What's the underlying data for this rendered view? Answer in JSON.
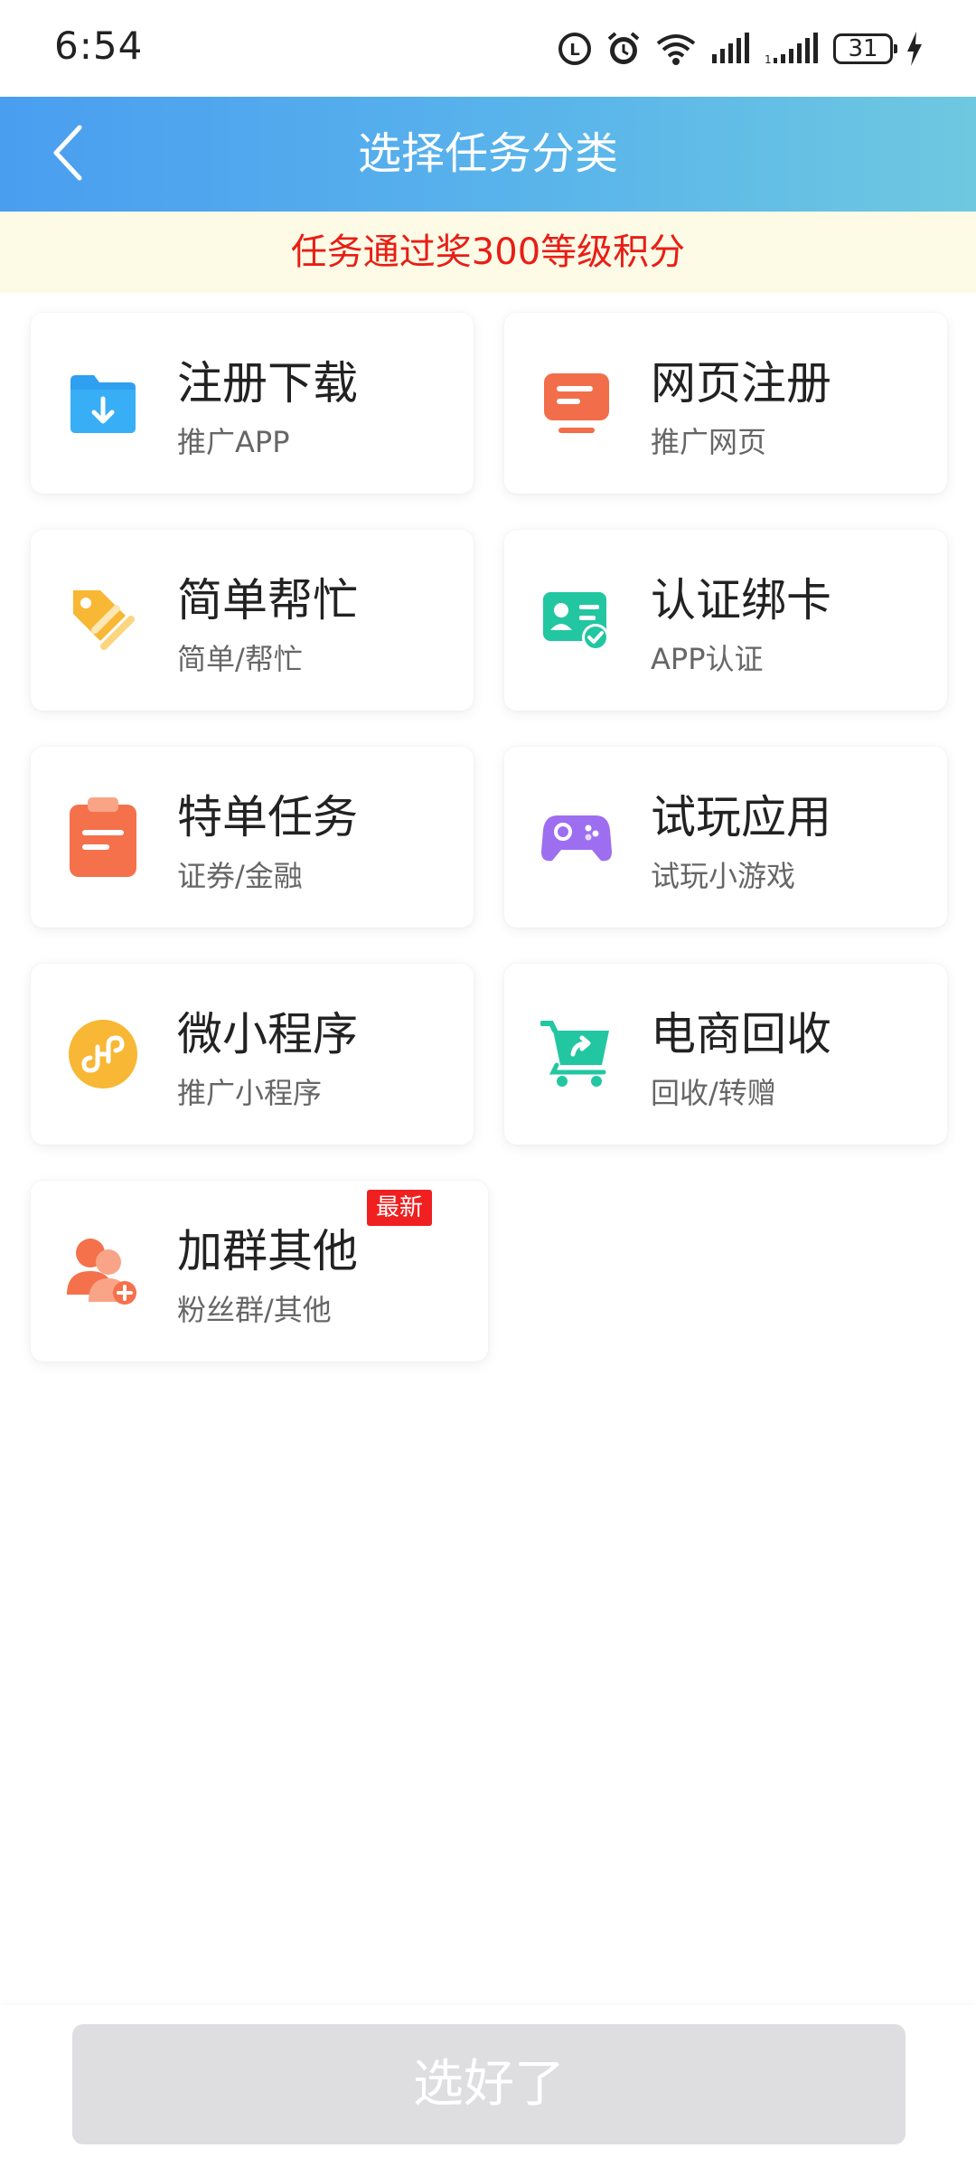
{
  "status_bar": {
    "time": "6:54",
    "battery": "31",
    "icons": [
      "data-saver-icon",
      "alarm-icon",
      "wifi-icon",
      "signal-icon",
      "signal-icon-2",
      "battery-icon",
      "charging-icon"
    ]
  },
  "header": {
    "title": "选择任务分类",
    "back_icon": "chevron-left-icon"
  },
  "notice": {
    "text": "任务通过奖300等级积分"
  },
  "categories": [
    {
      "title": "注册下载",
      "subtitle": "推广APP",
      "icon": "folder-download-icon",
      "color": "#2f9ff0"
    },
    {
      "title": "网页注册",
      "subtitle": "推广网页",
      "icon": "webpage-icon",
      "color": "#f26e4a"
    },
    {
      "title": "简单帮忙",
      "subtitle": "简单/帮忙",
      "icon": "tag-icon",
      "color": "#f8b734"
    },
    {
      "title": "认证绑卡",
      "subtitle": "APP认证",
      "icon": "id-card-icon",
      "color": "#22c7a1"
    },
    {
      "title": "特单任务",
      "subtitle": "证券/金融",
      "icon": "clipboard-icon",
      "color": "#f4714c"
    },
    {
      "title": "试玩应用",
      "subtitle": "试玩小游戏",
      "icon": "gamepad-icon",
      "color": "#9e6ef0"
    },
    {
      "title": "微小程序",
      "subtitle": "推广小程序",
      "icon": "mini-program-icon",
      "color": "#f8b734"
    },
    {
      "title": "电商回收",
      "subtitle": "回收/转赠",
      "icon": "shopping-cart-icon",
      "color": "#22c7a1"
    },
    {
      "title": "加群其他",
      "subtitle": "粉丝群/其他",
      "icon": "add-group-icon",
      "color": "#f4714c",
      "badge": "最新"
    }
  ],
  "footer": {
    "confirm_label": "选好了"
  }
}
